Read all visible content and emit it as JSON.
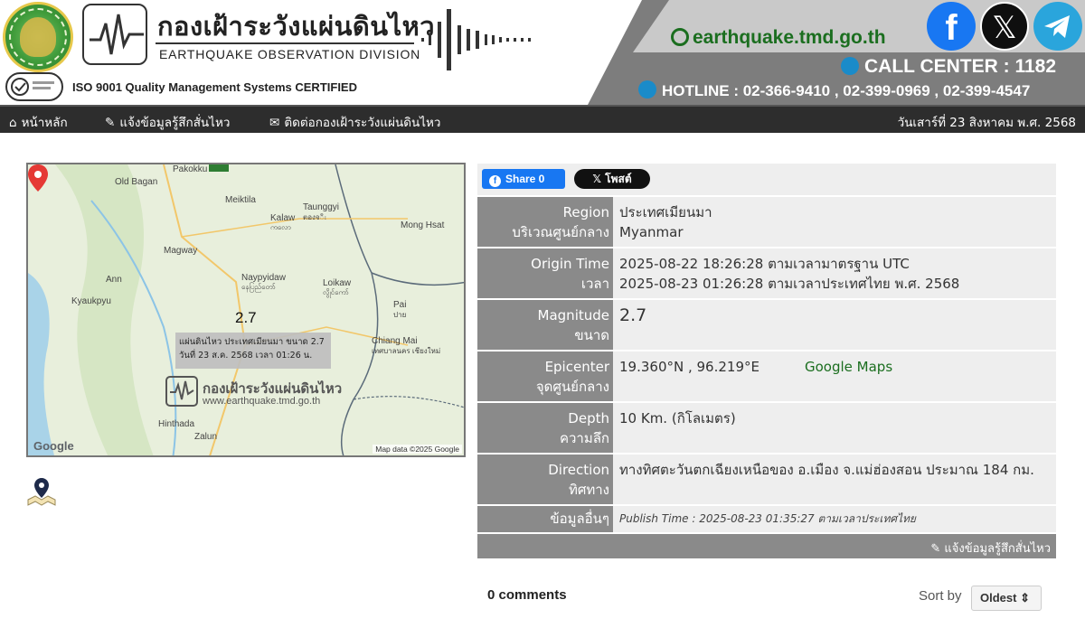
{
  "header": {
    "org_title_th": "กองเฝ้าระวังแผ่นดินไหว",
    "org_title_en": "EARTHQUAKE OBSERVATION DIVISION",
    "iso_text": "ISO 9001 Quality Management Systems CERTIFIED",
    "website": "earthquake.tmd.go.th",
    "call_center": "CALL CENTER : 1182",
    "hotline": "HOTLINE : 02-366-9410 , 02-399-0969 , 02-399-4547",
    "social": [
      {
        "name": "facebook",
        "glyph": "f"
      },
      {
        "name": "x",
        "glyph": "𝕏"
      },
      {
        "name": "telegram"
      }
    ]
  },
  "nav": {
    "items": [
      {
        "label": "หน้าหลัก",
        "icon": "home-icon"
      },
      {
        "label": "แจ้งข้อมูลรู้สึกสั่นไหว",
        "icon": "edit-form-icon"
      },
      {
        "label": "ติดต่อกองเฝ้าระวังแผ่นดินไหว",
        "icon": "mail-icon"
      }
    ],
    "date": "วันเสาร์ที่ 23 สิงหาคม พ.ศ. 2568"
  },
  "map": {
    "places": [
      "Pakokku",
      "Old Bagan",
      "Meiktila",
      "Taunggyi",
      "Kalaw",
      "Mong Hsat",
      "Magway",
      "Naypyidaw",
      "Ann",
      "Loikaw",
      "Kyaukpyu",
      "Pai",
      "Chiang Mai",
      "Hinthada",
      "Zalun"
    ],
    "places_local": [
      "ตองจီး",
      "ကလော",
      "နေပြည်တော်",
      "လွိုင်ကော်",
      "ปาย",
      "เทศบาลนคร เชียงใหม่"
    ],
    "marker_magnitude": "2.7",
    "popup_line1": "แผ่นดินไหว ประเทศเมียนมา ขนาด 2.7",
    "popup_line2": "วันที่ 23 ส.ค. 2568 เวลา 01:26 น.",
    "watermark_title": "กองเฝ้าระวังแผ่นดินไหว",
    "watermark_url": "www.earthquake.tmd.go.th",
    "google_logo": "Google",
    "attribution": "Map data ©2025 Google"
  },
  "share": {
    "fb_label": "Share 0",
    "x_label": "𝕏 โพสต์"
  },
  "details": {
    "region": {
      "label_en": "Region",
      "label_th": "บริเวณศูนย์กลาง",
      "value_th": "ประเทศเมียนมา",
      "value_en": "Myanmar"
    },
    "origin_time": {
      "label_en": "Origin Time",
      "label_th": "เวลา",
      "utc": "2025-08-22 18:26:28 ตามเวลามาตรฐาน UTC",
      "local": "2025-08-23 01:26:28 ตามเวลาประเทศไทย พ.ศ. 2568"
    },
    "magnitude": {
      "label_en": "Magnitude",
      "label_th": "ขนาด",
      "value": "2.7"
    },
    "epicenter": {
      "label_en": "Epicenter",
      "label_th": "จุดศูนย์กลาง",
      "value": "19.360°N , 96.219°E",
      "maps_link": "Google Maps"
    },
    "depth": {
      "label_en": "Depth",
      "label_th": "ความลึก",
      "value": "10 Km. (กิโลเมตร)"
    },
    "direction": {
      "label_en": "Direction",
      "label_th": "ทิศทาง",
      "value": "ทางทิศตะวันตกเฉียงเหนือของ อ.เมือง จ.แม่ฮ่องสอน ประมาณ 184 กม."
    },
    "other": {
      "label_th": "ข้อมูลอื่นๆ",
      "publish": "Publish Time : 2025-08-23 01:35:27 ตามเวลาประเทศไทย"
    },
    "report_link": "แจ้งข้อมูลรู้สึกสั่นไหว"
  },
  "comments": {
    "count_label": "0 comments",
    "sort_label": "Sort by",
    "sort_value": "Oldest ⇕"
  },
  "colors": {
    "nav_bg": "#2d2d2d",
    "label_bg": "#8a8a8a",
    "value_bg": "#eeeeee",
    "accent_green": "#1b6e1f",
    "facebook": "#1877f2",
    "telegram": "#2aa5dc",
    "pin": "#e53935"
  }
}
